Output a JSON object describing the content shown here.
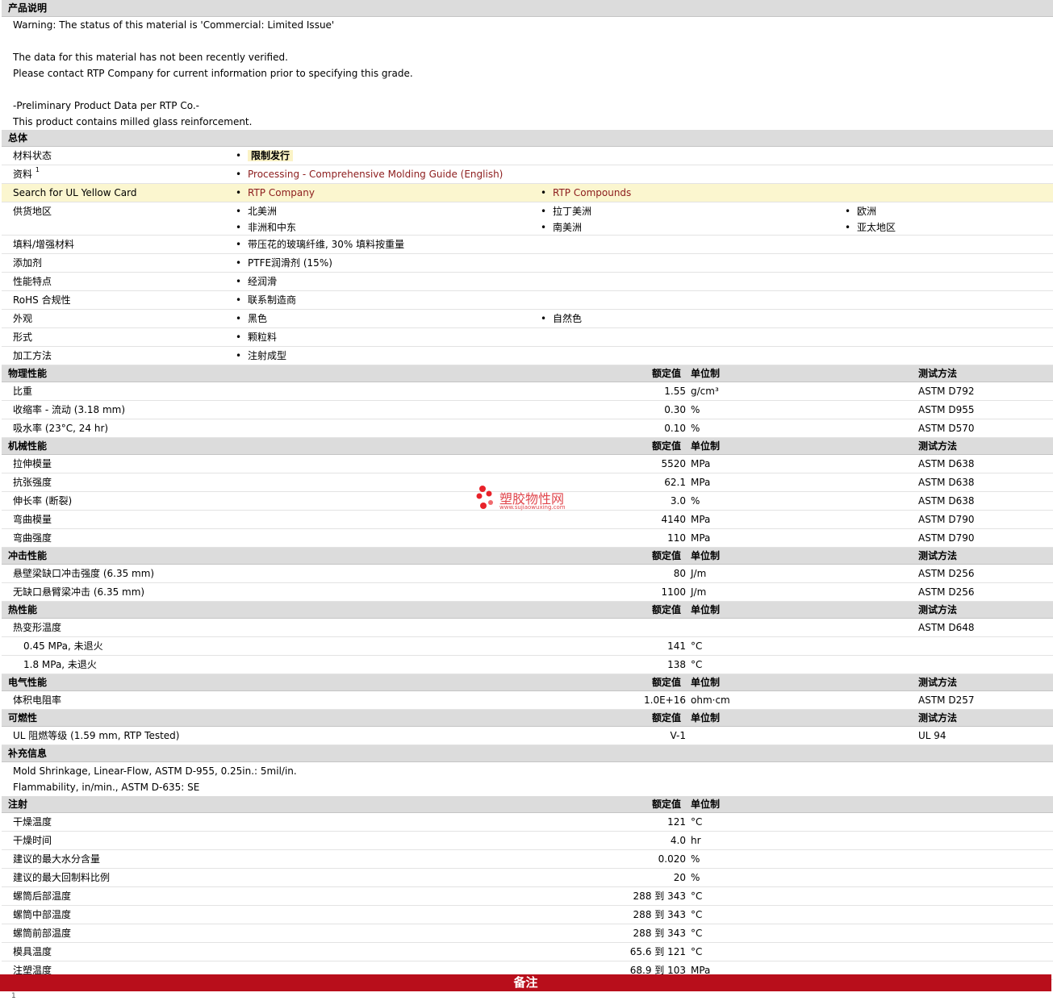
{
  "description": {
    "title": "产品说明",
    "lines": [
      "Warning: The status of this material is 'Commercial: Limited Issue'",
      "",
      "The data for this material has not been recently verified.",
      "Please contact RTP Company for current information prior to specifying this grade.",
      "",
      "-Preliminary Product Data per RTP Co.-",
      "This product contains milled glass reinforcement."
    ]
  },
  "general": {
    "title": "总体",
    "status_label": "材料状态",
    "status_value": "限制发行",
    "docs_label": "资料",
    "docs_sup": "1",
    "docs_link": "Processing - Comprehensive Molding Guide (English)",
    "ul_label": "Search for UL Yellow Card",
    "ul_links": [
      "RTP Company",
      "RTP Compounds"
    ],
    "region_label": "供货地区",
    "regions": [
      "北美洲",
      "拉丁美洲",
      "欧洲",
      "非洲和中东",
      "南美洲",
      "亚太地区"
    ],
    "filler_label": "填料/增强材料",
    "filler_value": "带压花的玻璃纤维, 30% 填料按重量",
    "additive_label": "添加剂",
    "additive_value": "PTFE润滑剂 (15%)",
    "feature_label": "性能特点",
    "feature_value": "经润滑",
    "rohs_label": "RoHS 合规性",
    "rohs_value": "联系制造商",
    "appearance_label": "外观",
    "appearance_values": [
      "黑色",
      "自然色"
    ],
    "form_label": "形式",
    "form_value": "颗粒料",
    "process_label": "加工方法",
    "process_value": "注射成型"
  },
  "headers": {
    "value": "额定值",
    "unit": "单位制",
    "method": "测试方法"
  },
  "physical": {
    "title": "物理性能",
    "rows": [
      {
        "label": "比重",
        "value": "1.55",
        "unit": "g/cm³",
        "method": "ASTM D792"
      },
      {
        "label": "收缩率  - 流动  (3.18 mm)",
        "value": "0.30",
        "unit": "%",
        "method": "ASTM D955"
      },
      {
        "label": "吸水率  (23°C, 24 hr)",
        "value": "0.10",
        "unit": "%",
        "method": "ASTM D570"
      }
    ]
  },
  "mechanical": {
    "title": "机械性能",
    "rows": [
      {
        "label": "拉伸模量",
        "value": "5520",
        "unit": "MPa",
        "method": "ASTM D638"
      },
      {
        "label": "抗张强度",
        "value": "62.1",
        "unit": "MPa",
        "method": "ASTM D638"
      },
      {
        "label": "伸长率  (断裂)",
        "value": "3.0",
        "unit": "%",
        "method": "ASTM D638"
      },
      {
        "label": "弯曲模量",
        "value": "4140",
        "unit": "MPa",
        "method": "ASTM D790"
      },
      {
        "label": "弯曲强度",
        "value": "110",
        "unit": "MPa",
        "method": "ASTM D790"
      }
    ]
  },
  "impact": {
    "title": "冲击性能",
    "rows": [
      {
        "label": "悬壁梁缺口冲击强度  (6.35 mm)",
        "value": "80",
        "unit": "J/m",
        "method": "ASTM D256"
      },
      {
        "label": "无缺口悬臂梁冲击  (6.35 mm)",
        "value": "1100",
        "unit": "J/m",
        "method": "ASTM D256"
      }
    ]
  },
  "thermal": {
    "title": "热性能",
    "parent_label": "热变形温度",
    "parent_method": "ASTM D648",
    "rows": [
      {
        "label": "0.45 MPa, 未退火",
        "value": "141",
        "unit": "°C"
      },
      {
        "label": "1.8 MPa, 未退火",
        "value": "138",
        "unit": "°C"
      }
    ]
  },
  "electrical": {
    "title": "电气性能",
    "rows": [
      {
        "label": "体积电阻率",
        "value": "1.0E+16",
        "unit": "ohm·cm",
        "method": "ASTM D257"
      }
    ]
  },
  "flammability": {
    "title": "可燃性",
    "rows": [
      {
        "label": "UL 阻燃等级  (1.59 mm, RTP Tested)",
        "value": "V-1",
        "unit": "",
        "method": "UL 94"
      }
    ]
  },
  "supplement": {
    "title": "补充信息",
    "lines": [
      "Mold Shrinkage, Linear-Flow, ASTM D-955, 0.25in.: 5mil/in.",
      "Flammability, in/min., ASTM D-635: SE"
    ]
  },
  "injection": {
    "title": "注射",
    "rows": [
      {
        "label": "干燥温度",
        "value": "121",
        "unit": "°C"
      },
      {
        "label": "干燥时间",
        "value": "4.0",
        "unit": "hr"
      },
      {
        "label": "建议的最大水分含量",
        "value": "0.020",
        "unit": "%"
      },
      {
        "label": "建议的最大回制料比例",
        "value": "20",
        "unit": "%"
      },
      {
        "label": "螺筒后部温度",
        "value": "288 到  343",
        "unit": "°C"
      },
      {
        "label": "螺筒中部温度",
        "value": "288 到  343",
        "unit": "°C"
      },
      {
        "label": "螺筒前部温度",
        "value": "288 到  343",
        "unit": "°C"
      },
      {
        "label": "模具温度",
        "value": "65.6 到  121",
        "unit": "°C"
      },
      {
        "label": "注塑温度",
        "value": "68.9 到  103",
        "unit": "MPa"
      }
    ]
  },
  "notes": {
    "title": "备注"
  },
  "watermark": {
    "title": "塑胶物性网",
    "url": "www.sujiaowuxing.com",
    "color": "#e0464c"
  },
  "colors": {
    "link": "#8c1c1c",
    "notes_bar": "#b80e1b",
    "highlight_row": "#fbf6cf",
    "section_bg": "#dcdcdc"
  }
}
